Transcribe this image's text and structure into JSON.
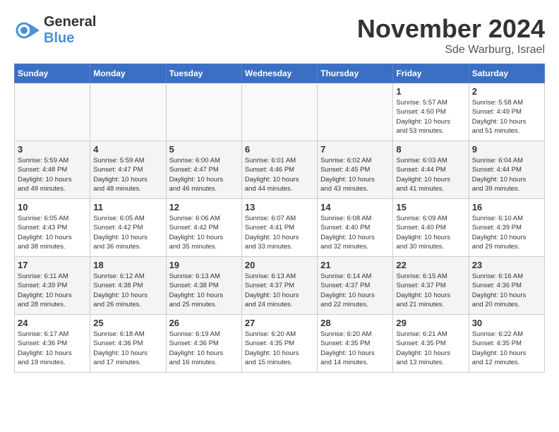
{
  "header": {
    "logo_general": "General",
    "logo_blue": "Blue",
    "title": "November 2024",
    "location": "Sde Warburg, Israel"
  },
  "days_of_week": [
    "Sunday",
    "Monday",
    "Tuesday",
    "Wednesday",
    "Thursday",
    "Friday",
    "Saturday"
  ],
  "weeks": [
    [
      {
        "day": "",
        "info": ""
      },
      {
        "day": "",
        "info": ""
      },
      {
        "day": "",
        "info": ""
      },
      {
        "day": "",
        "info": ""
      },
      {
        "day": "",
        "info": ""
      },
      {
        "day": "1",
        "info": "Sunrise: 5:57 AM\nSunset: 4:50 PM\nDaylight: 10 hours\nand 53 minutes."
      },
      {
        "day": "2",
        "info": "Sunrise: 5:58 AM\nSunset: 4:49 PM\nDaylight: 10 hours\nand 51 minutes."
      }
    ],
    [
      {
        "day": "3",
        "info": "Sunrise: 5:59 AM\nSunset: 4:48 PM\nDaylight: 10 hours\nand 49 minutes."
      },
      {
        "day": "4",
        "info": "Sunrise: 5:59 AM\nSunset: 4:47 PM\nDaylight: 10 hours\nand 48 minutes."
      },
      {
        "day": "5",
        "info": "Sunrise: 6:00 AM\nSunset: 4:47 PM\nDaylight: 10 hours\nand 46 minutes."
      },
      {
        "day": "6",
        "info": "Sunrise: 6:01 AM\nSunset: 4:46 PM\nDaylight: 10 hours\nand 44 minutes."
      },
      {
        "day": "7",
        "info": "Sunrise: 6:02 AM\nSunset: 4:45 PM\nDaylight: 10 hours\nand 43 minutes."
      },
      {
        "day": "8",
        "info": "Sunrise: 6:03 AM\nSunset: 4:44 PM\nDaylight: 10 hours\nand 41 minutes."
      },
      {
        "day": "9",
        "info": "Sunrise: 6:04 AM\nSunset: 4:44 PM\nDaylight: 10 hours\nand 39 minutes."
      }
    ],
    [
      {
        "day": "10",
        "info": "Sunrise: 6:05 AM\nSunset: 4:43 PM\nDaylight: 10 hours\nand 38 minutes."
      },
      {
        "day": "11",
        "info": "Sunrise: 6:05 AM\nSunset: 4:42 PM\nDaylight: 10 hours\nand 36 minutes."
      },
      {
        "day": "12",
        "info": "Sunrise: 6:06 AM\nSunset: 4:42 PM\nDaylight: 10 hours\nand 35 minutes."
      },
      {
        "day": "13",
        "info": "Sunrise: 6:07 AM\nSunset: 4:41 PM\nDaylight: 10 hours\nand 33 minutes."
      },
      {
        "day": "14",
        "info": "Sunrise: 6:08 AM\nSunset: 4:40 PM\nDaylight: 10 hours\nand 32 minutes."
      },
      {
        "day": "15",
        "info": "Sunrise: 6:09 AM\nSunset: 4:40 PM\nDaylight: 10 hours\nand 30 minutes."
      },
      {
        "day": "16",
        "info": "Sunrise: 6:10 AM\nSunset: 4:39 PM\nDaylight: 10 hours\nand 29 minutes."
      }
    ],
    [
      {
        "day": "17",
        "info": "Sunrise: 6:11 AM\nSunset: 4:39 PM\nDaylight: 10 hours\nand 28 minutes."
      },
      {
        "day": "18",
        "info": "Sunrise: 6:12 AM\nSunset: 4:38 PM\nDaylight: 10 hours\nand 26 minutes."
      },
      {
        "day": "19",
        "info": "Sunrise: 6:13 AM\nSunset: 4:38 PM\nDaylight: 10 hours\nand 25 minutes."
      },
      {
        "day": "20",
        "info": "Sunrise: 6:13 AM\nSunset: 4:37 PM\nDaylight: 10 hours\nand 24 minutes."
      },
      {
        "day": "21",
        "info": "Sunrise: 6:14 AM\nSunset: 4:37 PM\nDaylight: 10 hours\nand 22 minutes."
      },
      {
        "day": "22",
        "info": "Sunrise: 6:15 AM\nSunset: 4:37 PM\nDaylight: 10 hours\nand 21 minutes."
      },
      {
        "day": "23",
        "info": "Sunrise: 6:16 AM\nSunset: 4:36 PM\nDaylight: 10 hours\nand 20 minutes."
      }
    ],
    [
      {
        "day": "24",
        "info": "Sunrise: 6:17 AM\nSunset: 4:36 PM\nDaylight: 10 hours\nand 19 minutes."
      },
      {
        "day": "25",
        "info": "Sunrise: 6:18 AM\nSunset: 4:36 PM\nDaylight: 10 hours\nand 17 minutes."
      },
      {
        "day": "26",
        "info": "Sunrise: 6:19 AM\nSunset: 4:36 PM\nDaylight: 10 hours\nand 16 minutes."
      },
      {
        "day": "27",
        "info": "Sunrise: 6:20 AM\nSunset: 4:35 PM\nDaylight: 10 hours\nand 15 minutes."
      },
      {
        "day": "28",
        "info": "Sunrise: 6:20 AM\nSunset: 4:35 PM\nDaylight: 10 hours\nand 14 minutes."
      },
      {
        "day": "29",
        "info": "Sunrise: 6:21 AM\nSunset: 4:35 PM\nDaylight: 10 hours\nand 13 minutes."
      },
      {
        "day": "30",
        "info": "Sunrise: 6:22 AM\nSunset: 4:35 PM\nDaylight: 10 hours\nand 12 minutes."
      }
    ]
  ]
}
